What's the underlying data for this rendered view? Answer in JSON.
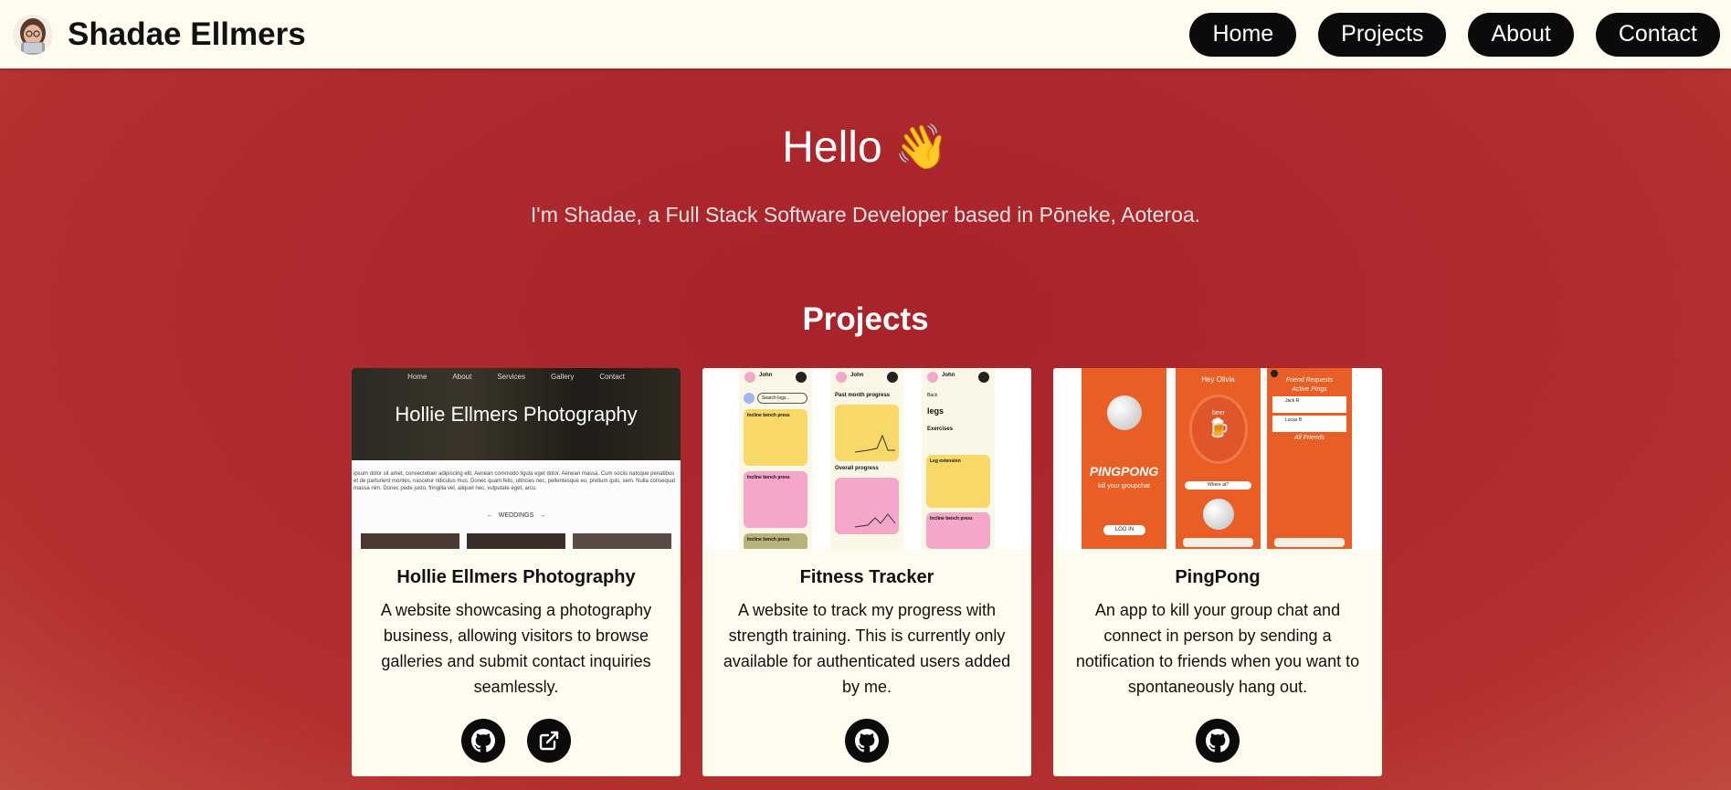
{
  "header": {
    "brand_name": "Shadae Ellmers",
    "nav": [
      "Home",
      "Projects",
      "About",
      "Contact"
    ]
  },
  "hero": {
    "title": "Hello 👋",
    "subtitle": "I'm Shadae, a Full Stack Software Developer based in Pōneke, Aoteroa."
  },
  "projects": {
    "heading": "Projects",
    "items": [
      {
        "title": "Hollie Ellmers Photography",
        "description": "A website showcasing a photography business, allowing visitors to browse galleries and submit contact inquiries seamlessly.",
        "links": [
          "github-icon",
          "external-link-icon"
        ],
        "preview": {
          "nav": [
            "Home",
            "About",
            "Services",
            "Gallery",
            "Contact"
          ],
          "heading": "Hollie Ellmers Photography",
          "lorem": "ipsum dolor sit amet, consectetuer adipiscing elit. Aenean commodo ligula eget dolor. Aenean massa. Cum sociis natoque penatibus et de parturient montes, nascetur ridiculus mus. Donec quam felis, ultricies nec, pellentesque eu, pretium quis, sem. Nulla consequat massa nim. Donec pede justo, fringilla vel, aliquet nec, vulputate eget, arcu.",
          "carousel_label": "WEDDINGS"
        }
      },
      {
        "title": "Fitness Tracker",
        "description": "A website to track my progress with strength training. This is currently only available for authenticated users added by me.",
        "links": [
          "github-icon"
        ],
        "preview": {
          "screen1": {
            "user": "John",
            "search": "Search logs...",
            "cards": [
              "Incline bench press",
              "Incline bench press",
              "Incline bench press"
            ]
          },
          "screen2": {
            "user": "John",
            "month_title": "Past month progress",
            "overall_title": "Overall progress"
          },
          "screen3": {
            "user": "John",
            "back": "Back",
            "title": "legs",
            "exercises": "Exercises",
            "cards": [
              "Leg extension",
              "Incline bench press"
            ]
          }
        }
      },
      {
        "title": "PingPong",
        "description": "An app to kill your group chat and connect in person by sending a notification to friends when you want to spontaneously hang out.",
        "links": [
          "github-icon"
        ],
        "preview": {
          "logo": "PINGPONG",
          "tagline": "kill your groupchat",
          "login": "LOG IN",
          "greeting": "Hey Olivia",
          "drink": "beer",
          "where": "Where at?",
          "friend_requests": "Friend Requests",
          "active_pings": "Active Pings",
          "ping1": "Jack R",
          "ping2": "Lucas B",
          "all_friends": "All Friends"
        }
      }
    ]
  },
  "colors": {
    "header_bg": "#fdfcee",
    "card_bg": "#fdfcee",
    "button_bg": "#0b0b0b",
    "page_bg": "#ad2a2e",
    "pingpong_orange": "#e85e25",
    "fitness_yellow": "#f9d86a",
    "fitness_pink": "#f4a7c9"
  }
}
